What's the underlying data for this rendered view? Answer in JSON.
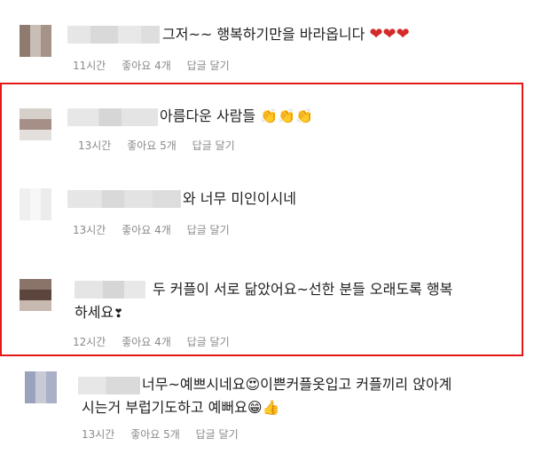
{
  "comments": [
    {
      "text": "그저~~ 행복하기만을 바라옵니다",
      "emoji": "❤❤❤",
      "time": "11시간",
      "likes": "좋아요 4개",
      "reply": "답글 달기"
    },
    {
      "text": "아름다운 사람들",
      "emoji": "👏👏👏",
      "time": "13시간",
      "likes": "좋아요 5개",
      "reply": "답글 달기"
    },
    {
      "text": "와 너무 미인이시네",
      "emoji": "",
      "time": "13시간",
      "likes": "좋아요 4개",
      "reply": "답글 달기"
    },
    {
      "text_line1": "두 커플이 서로 닮았어요~선한 분들 오래도록 행복",
      "text_line2": "하세요",
      "emoji": "❣",
      "time": "12시간",
      "likes": "좋아요 4개",
      "reply": "답글 달기"
    },
    {
      "text_line1": "너무~예쁘시네요",
      "emoji1": "😍",
      "text_line1b": "이쁜커플옷입고 커플끼리 앉아계",
      "text_line2": "시는거 부럽기도하고 예뻐요",
      "emoji2": "😁👍",
      "time": "13시간",
      "likes": "좋아요 5개",
      "reply": "답글 달기"
    }
  ],
  "colors": {
    "highlight_border": "#e41818",
    "meta_text": "#8a8a8a",
    "heart": "#d42a2a"
  }
}
